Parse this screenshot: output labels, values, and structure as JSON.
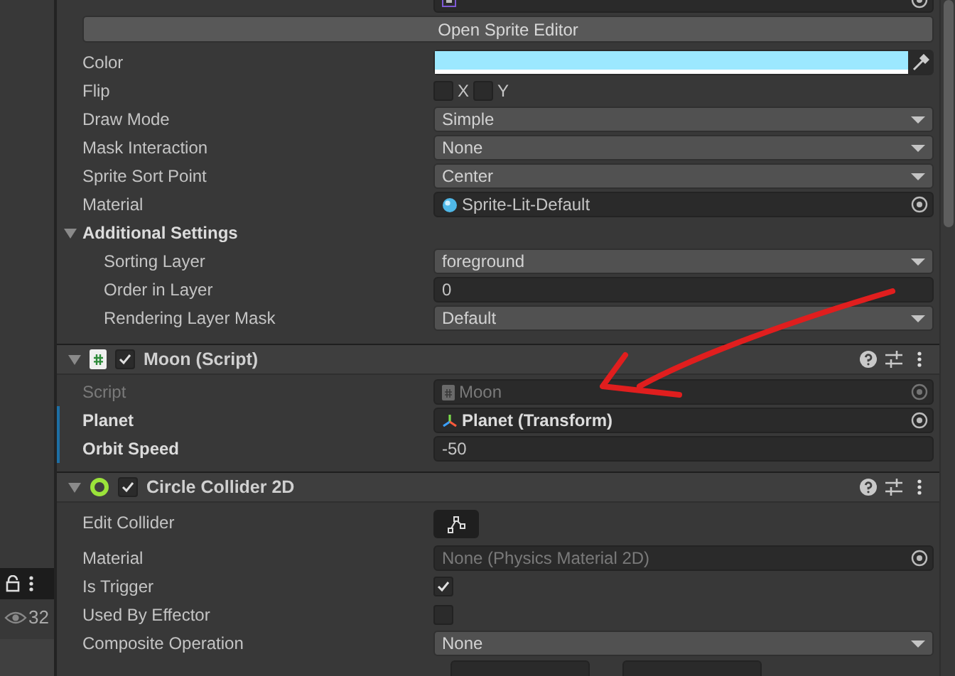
{
  "sidebar": {
    "visibility_count": "32"
  },
  "sprite_renderer": {
    "fields": [
      {
        "kind": "object"
      },
      {
        "kind": "button",
        "label": "Open Sprite Editor"
      },
      {
        "kind": "color",
        "label": "Color",
        "color": "#9ce8ff"
      },
      {
        "kind": "flip",
        "label": "Flip",
        "x_label": "X",
        "x_checked": false,
        "y_label": "Y",
        "y_checked": false
      },
      {
        "kind": "dropdown",
        "label": "Draw Mode",
        "value": "Simple"
      },
      {
        "kind": "dropdown",
        "label": "Mask Interaction",
        "value": "None"
      },
      {
        "kind": "dropdown",
        "label": "Sprite Sort Point",
        "value": "Center"
      },
      {
        "kind": "object",
        "label": "Material",
        "value": "Sprite-Lit-Default"
      },
      {
        "kind": "foldout",
        "label": "Additional Settings",
        "expanded": true,
        "children": [
          {
            "kind": "dropdown",
            "label": "Sorting Layer",
            "value": "foreground"
          },
          {
            "kind": "text",
            "label": "Order in Layer",
            "value": "0"
          },
          {
            "kind": "dropdown",
            "label": "Rendering Layer Mask",
            "value": "Default"
          }
        ]
      }
    ]
  },
  "components": [
    {
      "title": "Moon (Script)",
      "enabled": true,
      "expanded": true,
      "fields": [
        {
          "kind": "object",
          "label": "Script",
          "value": "Moon",
          "disabled": true
        },
        {
          "kind": "object",
          "label": "Planet",
          "value": "Planet (Transform)",
          "modified": true
        },
        {
          "kind": "text",
          "label": "Orbit Speed",
          "value": "-50",
          "modified": true
        }
      ]
    },
    {
      "title": "Circle Collider 2D",
      "enabled": true,
      "expanded": true,
      "fields": [
        {
          "kind": "edit_collider",
          "label": "Edit Collider"
        },
        {
          "kind": "object",
          "label": "Material",
          "value": "None (Physics Material 2D)",
          "empty": true
        },
        {
          "kind": "checkbox",
          "label": "Is Trigger",
          "checked": true
        },
        {
          "kind": "checkbox",
          "label": "Used By Effector",
          "checked": false
        },
        {
          "kind": "dropdown",
          "label": "Composite Operation",
          "value": "None"
        },
        {
          "kind": "vector2"
        }
      ]
    }
  ]
}
